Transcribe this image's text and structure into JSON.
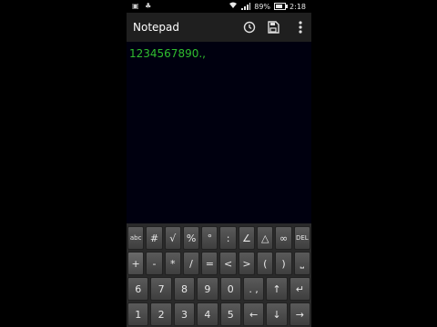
{
  "status_bar": {
    "left_icons": [
      "notification-icon",
      "android-icon"
    ],
    "battery": "89%",
    "time": "2:18"
  },
  "app_bar": {
    "title": "Notepad",
    "actions": [
      "history-icon",
      "save-icon",
      "overflow-menu-icon"
    ]
  },
  "editor": {
    "text": "1234567890.,",
    "text_color": "#2fbd2f",
    "background": "#00000f"
  },
  "keyboard": {
    "row1": [
      "abc",
      "#",
      "√",
      "%",
      "°",
      ":",
      "∠",
      "△",
      "∞",
      "DEL"
    ],
    "row2": [
      "+",
      "-",
      "*",
      "/",
      "=",
      "<",
      ">",
      "(",
      ")",
      "⎵"
    ],
    "row3": [
      "6",
      "7",
      "8",
      "9",
      "0",
      "↑",
      "↵"
    ],
    "row4": [
      "1",
      "2",
      "3",
      "4",
      "5",
      "←",
      "↓",
      "→"
    ]
  }
}
